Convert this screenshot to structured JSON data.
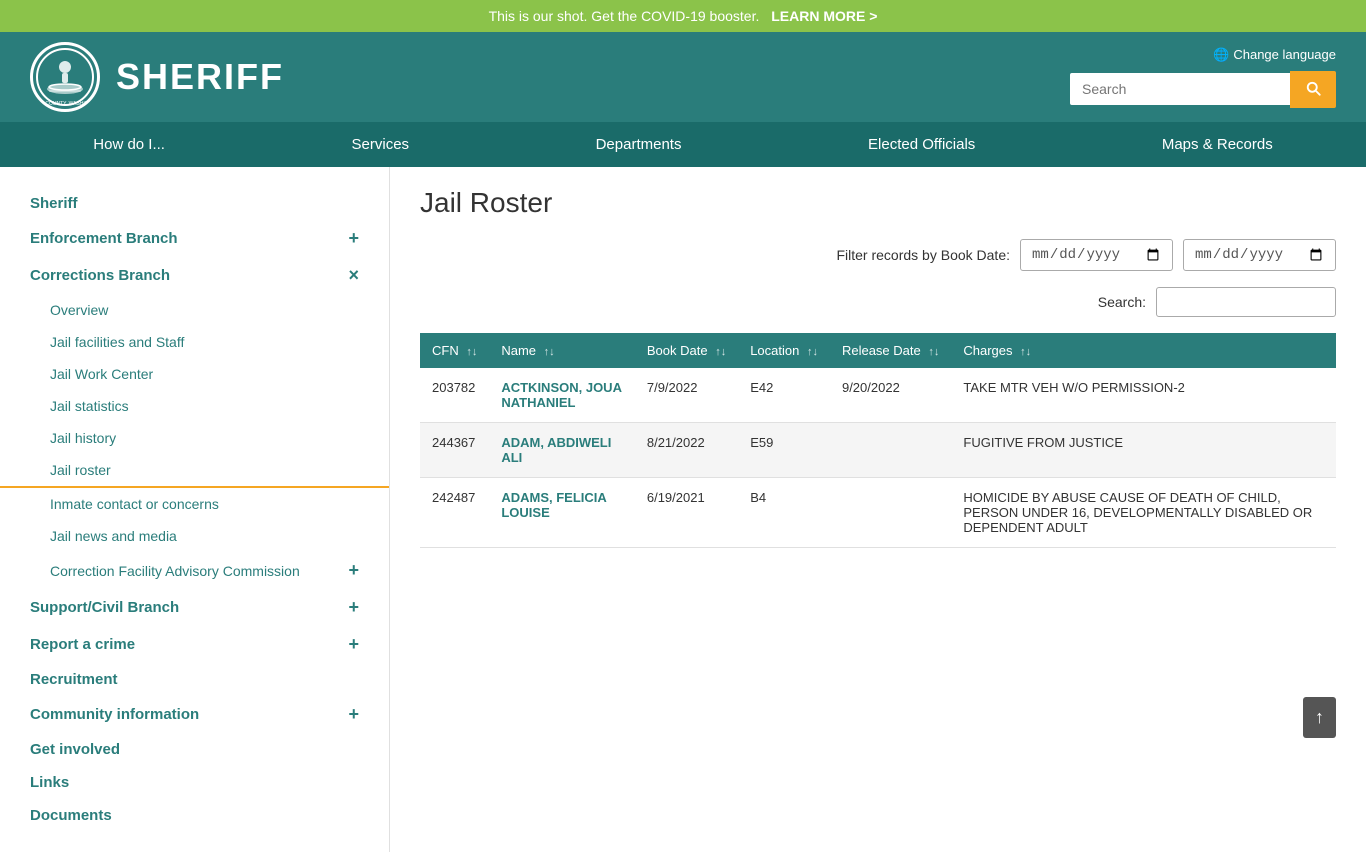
{
  "banner": {
    "text": "This is our shot. Get the COVID-19 booster.",
    "link": "LEARN MORE >"
  },
  "header": {
    "site_name": "SHERIFF",
    "change_language": "Change language",
    "search_placeholder": "Search"
  },
  "nav": {
    "items": [
      {
        "label": "How do I...",
        "id": "how-do-i"
      },
      {
        "label": "Services",
        "id": "services"
      },
      {
        "label": "Departments",
        "id": "departments"
      },
      {
        "label": "Elected Officials",
        "id": "elected-officials"
      },
      {
        "label": "Maps & Records",
        "id": "maps-records"
      }
    ]
  },
  "sidebar": {
    "top_items": [
      {
        "label": "Sheriff",
        "id": "sheriff",
        "expandable": false
      },
      {
        "label": "Enforcement Branch",
        "id": "enforcement-branch",
        "expandable": true,
        "expand_icon": "+"
      },
      {
        "label": "Corrections Branch",
        "id": "corrections-branch",
        "expandable": true,
        "expand_icon": "×"
      }
    ],
    "corrections_sub_items": [
      {
        "label": "Overview",
        "id": "overview",
        "active": false
      },
      {
        "label": "Jail facilities and Staff",
        "id": "jail-facilities",
        "active": false
      },
      {
        "label": "Jail Work Center",
        "id": "jail-work-center",
        "active": false
      },
      {
        "label": "Jail statistics",
        "id": "jail-statistics",
        "active": false
      },
      {
        "label": "Jail history",
        "id": "jail-history",
        "active": false
      },
      {
        "label": "Jail roster",
        "id": "jail-roster",
        "active": true
      },
      {
        "label": "Inmate contact or concerns",
        "id": "inmate-contact",
        "active": false
      },
      {
        "label": "Jail news and media",
        "id": "jail-news",
        "active": false
      },
      {
        "label": "Correction Facility Advisory Commission",
        "id": "cfac",
        "active": false,
        "expandable": true,
        "expand_icon": "+"
      }
    ],
    "bottom_items": [
      {
        "label": "Support/Civil Branch",
        "id": "support-civil",
        "expandable": true,
        "expand_icon": "+"
      },
      {
        "label": "Report a crime",
        "id": "report-crime",
        "expandable": true,
        "expand_icon": "+"
      },
      {
        "label": "Recruitment",
        "id": "recruitment",
        "expandable": false
      },
      {
        "label": "Community information",
        "id": "community-info",
        "expandable": true,
        "expand_icon": "+"
      },
      {
        "label": "Get involved",
        "id": "get-involved",
        "expandable": false
      },
      {
        "label": "Links",
        "id": "links",
        "expandable": false
      },
      {
        "label": "Documents",
        "id": "documents",
        "expandable": false
      }
    ]
  },
  "content": {
    "page_title": "Jail Roster",
    "filter_label": "Filter records by Book Date:",
    "search_label": "Search:",
    "table": {
      "columns": [
        {
          "key": "cfn",
          "label": "CFN",
          "sortable": true
        },
        {
          "key": "name",
          "label": "Name",
          "sortable": true
        },
        {
          "key": "book_date",
          "label": "Book Date",
          "sortable": true
        },
        {
          "key": "location",
          "label": "Location",
          "sortable": true
        },
        {
          "key": "release_date",
          "label": "Release Date",
          "sortable": true
        },
        {
          "key": "charges",
          "label": "Charges",
          "sortable": true
        }
      ],
      "rows": [
        {
          "cfn": "203782",
          "name": "ACTKINSON, JOUA NATHANIEL",
          "book_date": "7/9/2022",
          "location": "E42",
          "release_date": "9/20/2022",
          "charges": "TAKE MTR VEH W/O PERMISSION-2"
        },
        {
          "cfn": "244367",
          "name": "ADAM, ABDIWELI ALI",
          "book_date": "8/21/2022",
          "location": "E59",
          "release_date": "",
          "charges": "FUGITIVE FROM JUSTICE"
        },
        {
          "cfn": "242487",
          "name": "ADAMS, FELICIA LOUISE",
          "book_date": "6/19/2021",
          "location": "B4",
          "release_date": "",
          "charges": "HOMICIDE BY ABUSE CAUSE OF DEATH OF CHILD, PERSON UNDER 16, DEVELOPMENTALLY DISABLED OR DEPENDENT ADULT"
        }
      ]
    }
  },
  "scroll_top_label": "↑"
}
